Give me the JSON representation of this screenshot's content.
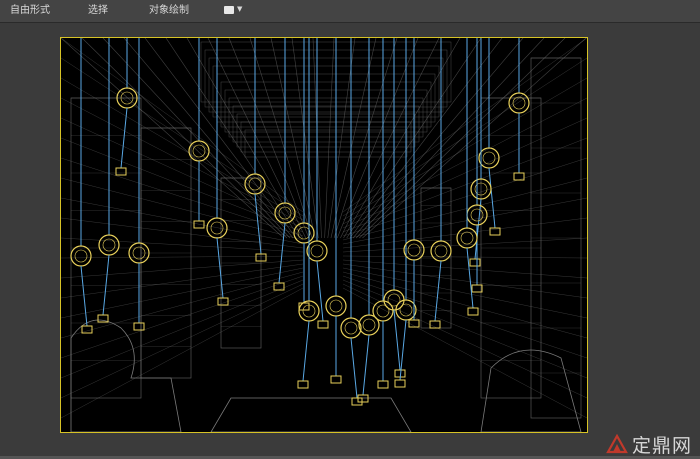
{
  "ribbon": {
    "tabs": [
      {
        "label": "自由形式"
      },
      {
        "label": "选择"
      },
      {
        "label": "对象绘制"
      }
    ],
    "dropdown_icon": "viewport-toggle-icon"
  },
  "viewport": {
    "mode": "wireframe",
    "frame_color": "#d7c326",
    "wire_color": "#7a7a7a",
    "lamp_color": "#e8d05a",
    "cable_color": "#5aa9e6",
    "background": "#000000"
  },
  "watermark": {
    "text": "定鼎网",
    "logo_icon": "zhuoding-logo-icon",
    "logo_color": "#c0392b"
  }
}
